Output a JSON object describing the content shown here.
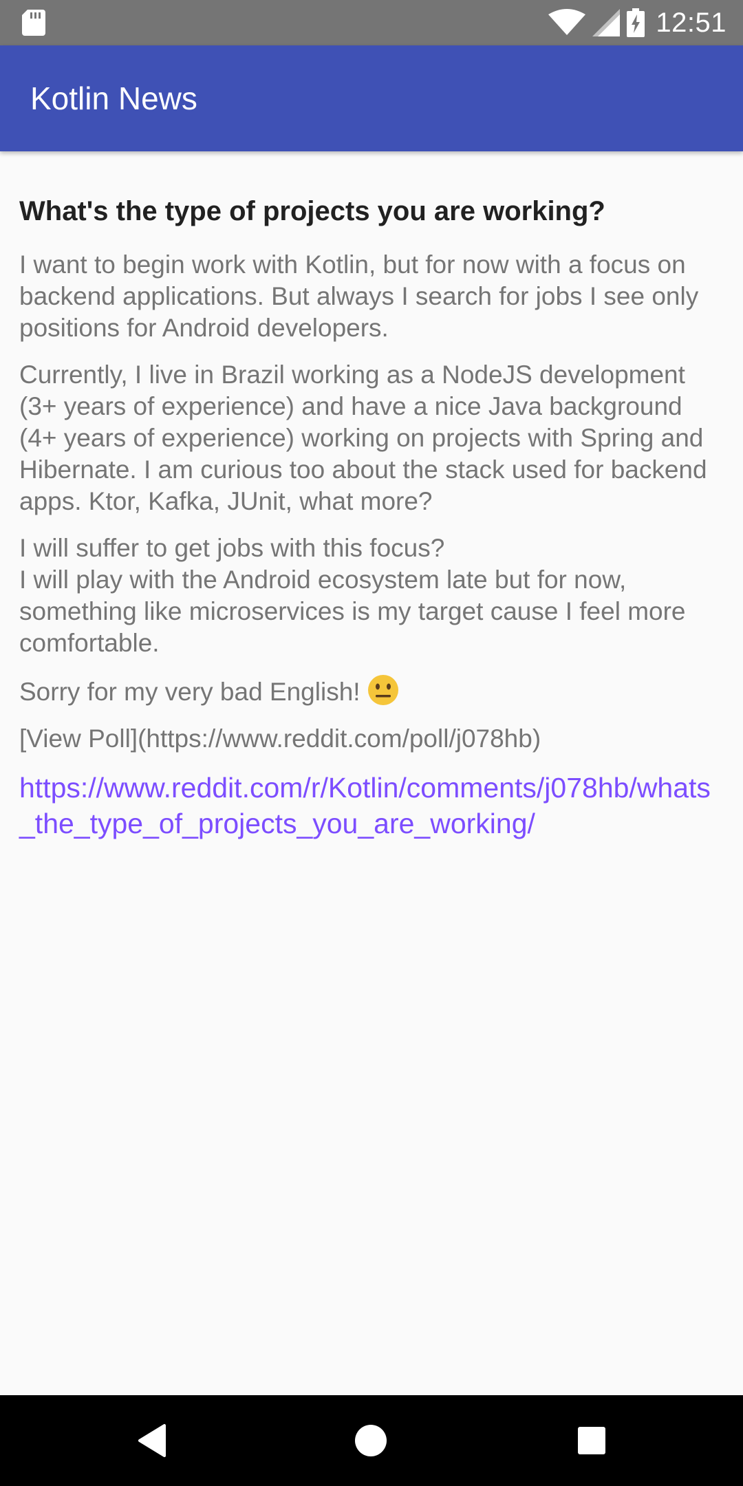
{
  "status_bar": {
    "time": "12:51",
    "icons": [
      "sd-card-icon",
      "wifi-icon",
      "signal-icon",
      "battery-charging-icon"
    ]
  },
  "app_bar": {
    "title": "Kotlin News",
    "color": "#3f51b5"
  },
  "post": {
    "title": "What's the type of projects you are working?",
    "body_paragraphs": [
      "I want to begin work with Kotlin, but for now with a focus on backend applications. But always I search for jobs I see only positions for Android developers.",
      "Currently, I live in Brazil working as a NodeJS development (3+ years of experience) and have a nice Java background (4+ years of experience) working on projects with Spring and Hibernate. I am curious too about the stack used for backend apps. Ktor, Kafka, JUnit, what more?",
      "I will suffer to get jobs with this focus?\nI will play with the Android ecosystem late but for now, something like microservices is my target cause I feel more comfortable.",
      "Sorry for my very bad English!",
      "[View Poll](https://www.reddit.com/poll/j078hb)"
    ],
    "emoji": "neutral-face-emoji",
    "link": "https://www.reddit.com/r/Kotlin/comments/j078hb/whats_the_type_of_projects_you_are_working/",
    "link_color": "#7c4dff"
  },
  "nav_bar": {
    "buttons": [
      "back-icon",
      "home-icon",
      "recents-icon"
    ]
  }
}
